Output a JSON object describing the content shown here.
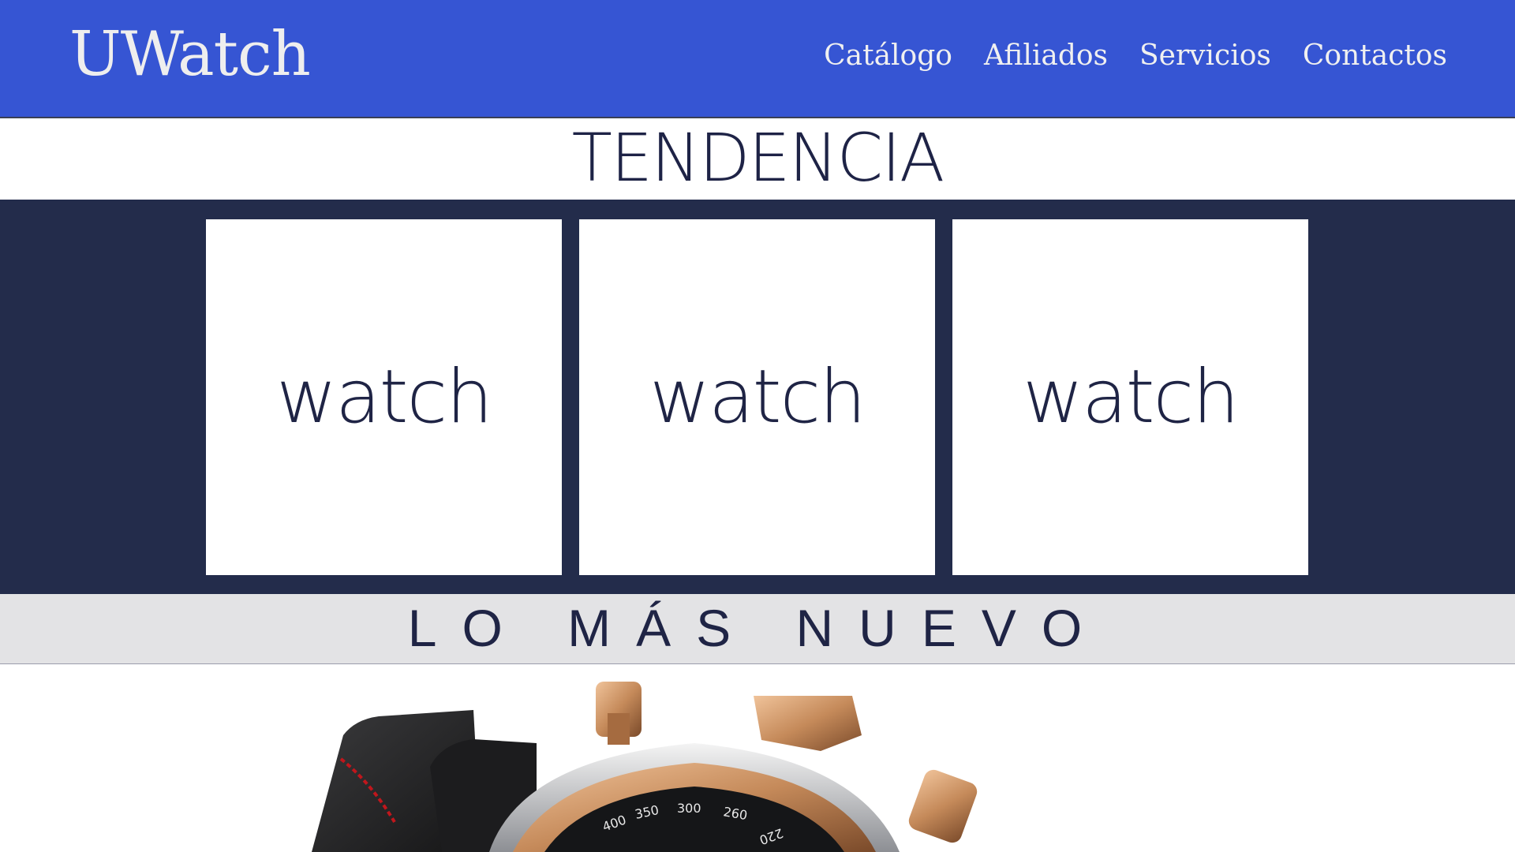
{
  "header": {
    "brand": "UWatch",
    "nav": [
      "Catálogo",
      "Afiliados",
      "Servicios",
      "Contactos"
    ]
  },
  "trend": {
    "title": "TENDENCIA",
    "cards": [
      "watch",
      "watch",
      "watch"
    ]
  },
  "new_section": {
    "title": "LO MÁS NUEVO"
  },
  "hero_image": {
    "icon": "chronograph-watch-image",
    "dial_numbers": [
      "400",
      "350",
      "300",
      "260",
      "220"
    ]
  },
  "colors": {
    "header_bg": "#3655d3",
    "band_bg": "#232c4b",
    "title_text": "#1e2346",
    "gray_band": "#e3e3e5",
    "bronze": "#c58a5a"
  }
}
